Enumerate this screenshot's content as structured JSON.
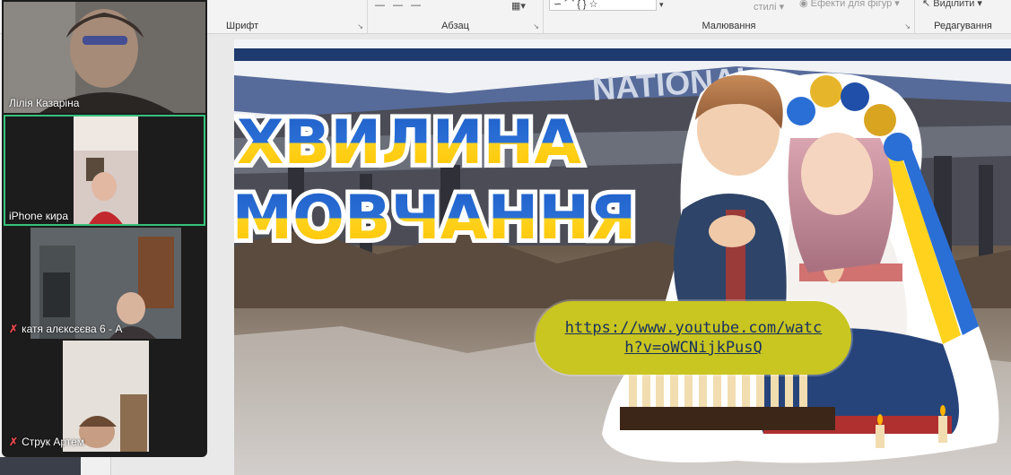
{
  "ribbon": {
    "groups": [
      {
        "label": "Шрифт"
      },
      {
        "label": "Абзац"
      },
      {
        "label": "Малювання"
      },
      {
        "label": "Редагування"
      }
    ],
    "styles_label": "стилі",
    "effects_label": "Ефекти для фігур",
    "select_label": "Виділити"
  },
  "slide": {
    "title_line1": "ХВИЛИНА",
    "title_line2": "МОВЧАННЯ",
    "sign_text": "NATIONAL",
    "link": "https://www.youtube.com/watch?v=oWCNijkPusQ"
  },
  "participants": [
    {
      "name": "Лілія Казаріна",
      "muted": false,
      "active": false
    },
    {
      "name": "iPhone кира",
      "muted": false,
      "active": true
    },
    {
      "name": "катя алєксєєва 6 - А",
      "muted": true,
      "active": false
    },
    {
      "name": "Струк Артем",
      "muted": true,
      "active": false
    }
  ],
  "colors": {
    "ukraine_blue": "#1f5fc8",
    "ukraine_yellow": "#ffd21e",
    "active_speaker": "#35c37b",
    "muted": "#e0474c"
  }
}
